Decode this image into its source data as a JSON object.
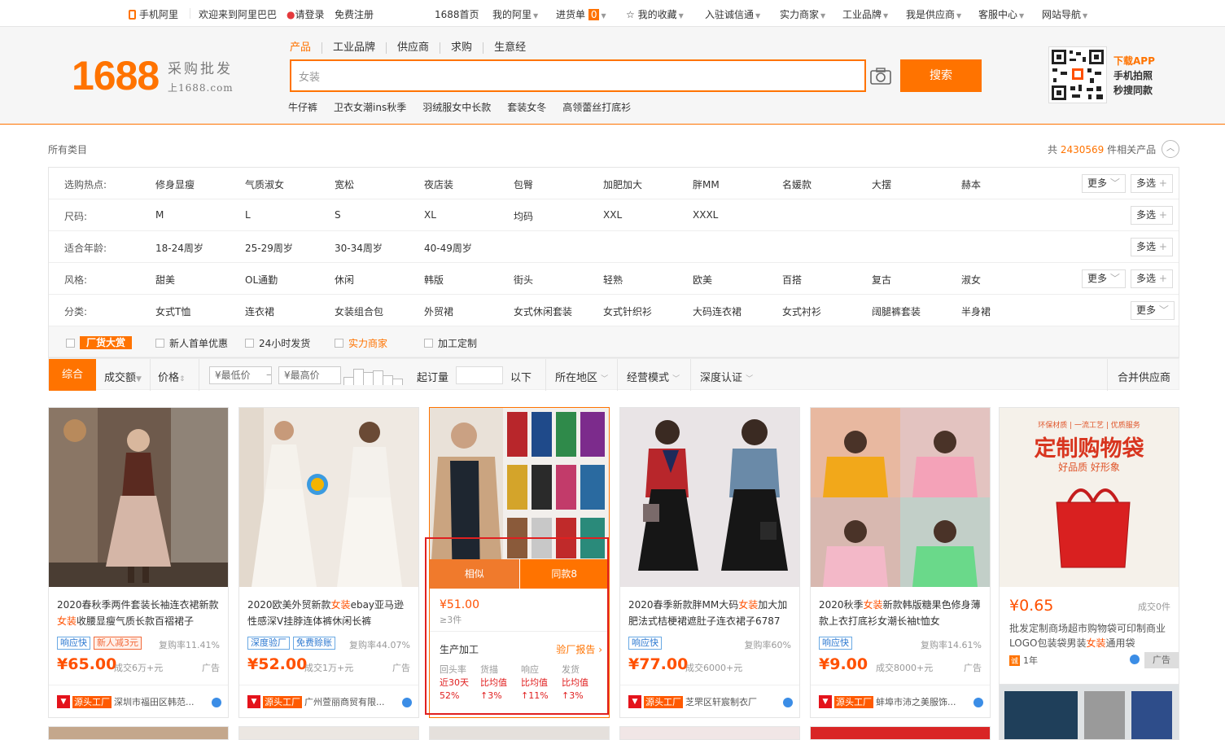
{
  "topbar": {
    "mobile": "手机阿里",
    "welcome": "欢迎来到阿里巴巴",
    "login": "请登录",
    "register": "免费注册",
    "home": "1688首页",
    "my_ali": "我的阿里",
    "cart": "进货单",
    "cart_count": "0",
    "fav": "我的收藏",
    "join": "入驻诚信通",
    "strong": "实力商家",
    "industrial": "工业品牌",
    "supplier": "我是供应商",
    "service": "客服中心",
    "sitenav": "网站导航"
  },
  "logo": {
    "num": "1688",
    "tagline": "采购批发",
    "domain": "上1688.com"
  },
  "search": {
    "tabs": [
      "产品",
      "工业品牌",
      "供应商",
      "求购",
      "生意经"
    ],
    "value": "女装",
    "button": "搜索",
    "hot": [
      "牛仔裤",
      "卫衣女潮ins秋季",
      "羽绒服女中长款",
      "套装女冬",
      "高领蕾丝打底衫"
    ]
  },
  "app": {
    "title": "下载APP",
    "line1": "手机拍照",
    "line2": "秒搜同款"
  },
  "breadcrumb": "所有类目",
  "result": {
    "prefix": "共",
    "count": "2430569",
    "suffix": "件相关产品"
  },
  "filters": [
    {
      "label": "选购热点:",
      "options": [
        "修身显瘦",
        "气质淑女",
        "宽松",
        "夜店装",
        "包臀",
        "加肥加大",
        "胖MM",
        "名媛款",
        "大摆",
        "赫本"
      ],
      "more": "更多",
      "multi": "多选"
    },
    {
      "label": "尺码:",
      "options": [
        "M",
        "L",
        "S",
        "XL",
        "均码",
        "XXL",
        "XXXL"
      ],
      "more": "",
      "multi": "多选"
    },
    {
      "label": "适合年龄:",
      "options": [
        "18-24周岁",
        "25-29周岁",
        "30-34周岁",
        "40-49周岁"
      ],
      "more": "",
      "multi": "多选"
    },
    {
      "label": "风格:",
      "options": [
        "甜美",
        "OL通勤",
        "休闲",
        "韩版",
        "街头",
        "轻熟",
        "欧美",
        "百搭",
        "复古",
        "淑女"
      ],
      "more": "更多",
      "multi": "多选"
    },
    {
      "label": "分类:",
      "options": [
        "女式T恤",
        "连衣裙",
        "女装组合包",
        "外贸裙",
        "女式休闲套装",
        "女式针织衫",
        "大码连衣裙",
        "女式衬衫",
        "阔腿裤套装",
        "半身裙"
      ],
      "more": "更多",
      "multi": ""
    }
  ],
  "checks": [
    "厂货大赏",
    "新人首单优惠",
    "24小时发货",
    "实力商家",
    "加工定制"
  ],
  "sort": {
    "general": "综合",
    "volume": "成交额",
    "price": "价格",
    "min": "¥最低价",
    "dash": "–",
    "max": "¥最高价",
    "moq": "起订量",
    "below": "以下",
    "region": "所在地区",
    "mode": "经营模式",
    "cert": "深度认证",
    "merge": "合并供应商"
  },
  "products": [
    {
      "title_pre": "2020春秋季两件套装长袖连衣裙新款",
      "title_k": "女装",
      "title_post": "收腰显瘦气质长款百褶裙子",
      "tags": [
        "响应快",
        "新人减3元"
      ],
      "rep": "复购率11.41%",
      "price": "¥65.00",
      "deal": "成交6万+元",
      "ad": "广告",
      "src": "源头工厂",
      "company": "深圳市福田区韩范..."
    },
    {
      "title_pre": "2020欧美外贸新款",
      "title_k": "女装",
      "title_post": "ebay亚马逊性感深V挂脖连体裤休闲长裤",
      "tags": [
        "深度验厂",
        "免费赊账"
      ],
      "rep": "复购率44.07%",
      "price": "¥52.00",
      "deal": "成交1万+元",
      "ad": "广告",
      "src": "源头工厂",
      "company": "广州萱丽商贸有限..."
    },
    {
      "similar": "相似",
      "same": "同款8",
      "price": "¥51.00",
      "moq": "≥3件",
      "service": "生产加工",
      "report": "验厂报告",
      "stats_h": [
        "回头率",
        "货描",
        "响应",
        "发货"
      ],
      "stats_l": [
        "近30天",
        "比均值",
        "比均值",
        "比均值"
      ],
      "stats_v": [
        "52%",
        "↑3%",
        "↑11%",
        "↑3%"
      ]
    },
    {
      "title_pre": "2020春季新款胖MM大码",
      "title_k": "女装",
      "title_post": "加大加肥法式桔梗裙遮肚子连衣裙子6787",
      "tags": [
        "响应快"
      ],
      "rep": "复购率60%",
      "price": "¥77.00",
      "deal": "成交6000+元",
      "ad": "",
      "src": "源头工厂",
      "company": "芝罘区轩宸制衣厂"
    },
    {
      "title_pre": "2020秋季",
      "title_k": "女装",
      "title_post": "新款韩版糖果色修身薄款上衣打底衫女潮长袖t恤女",
      "tags": [
        "响应快"
      ],
      "rep": "复购率14.61%",
      "price": "¥9.00",
      "deal": "成交8000+元",
      "ad": "广告",
      "src": "源头工厂",
      "company": "蚌埠市沛之美服饰..."
    },
    {
      "banner_small": "环保材质 | 一流工艺 | 优质服务",
      "banner_big": "定制购物袋",
      "banner_sub": "好品质 好形象",
      "price": "¥0.65",
      "deal": "成交0件",
      "title_pre": "批发定制商场超市购物袋可印制商业LOGO包装袋男装",
      "title_k": "女装",
      "title_post": "通用袋",
      "years": "1年",
      "ad": "广告"
    }
  ]
}
